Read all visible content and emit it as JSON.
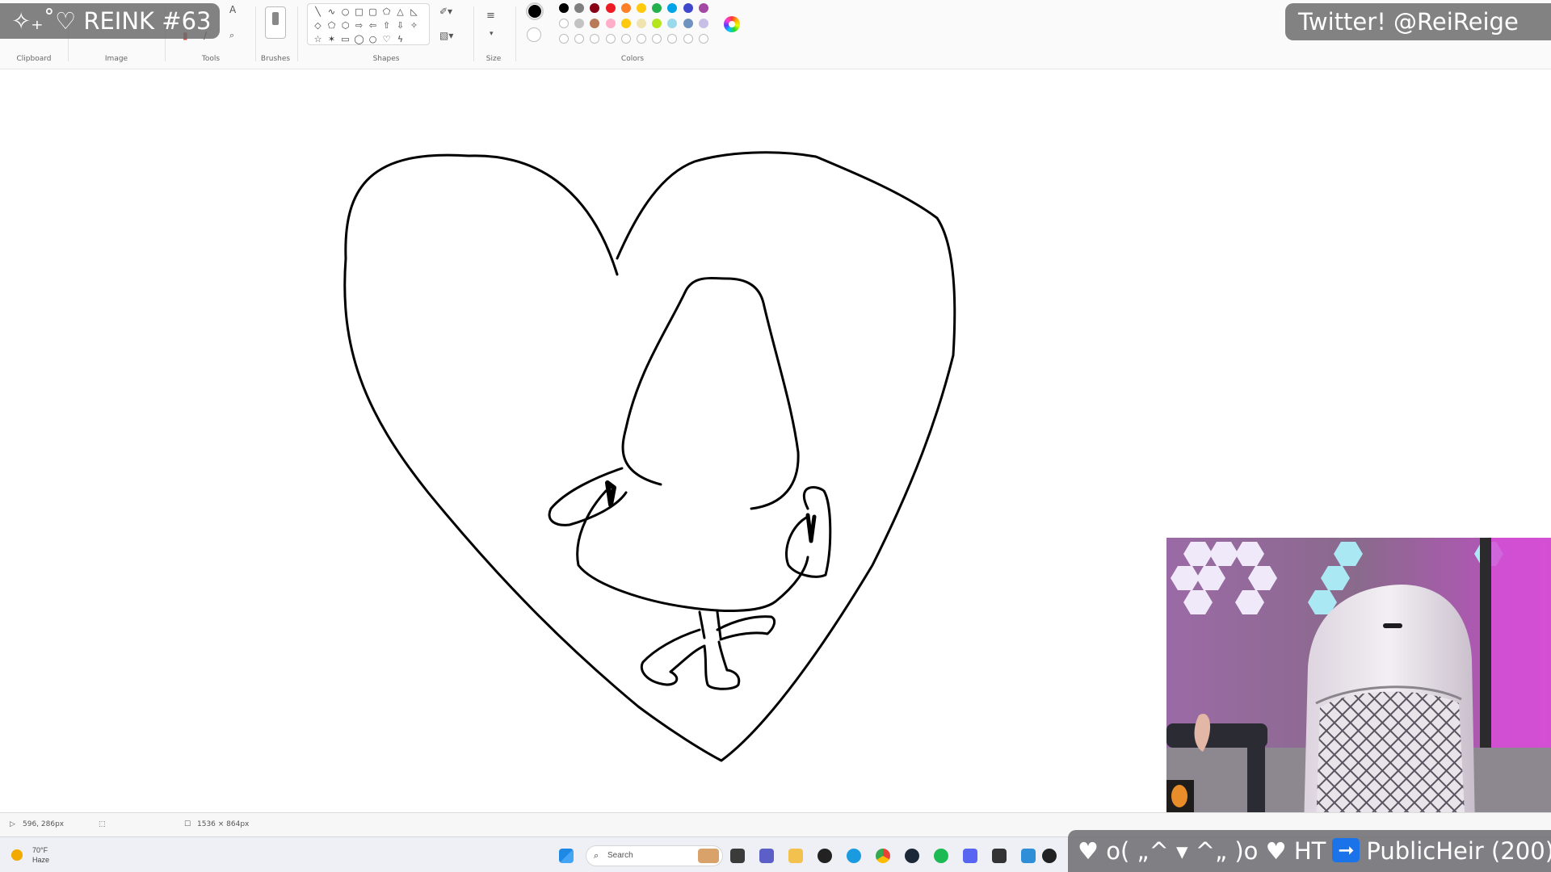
{
  "overlay": {
    "episode": "✧₊˚♡ REINK #63",
    "twitter": "Twitter! @ReiReige",
    "alert_prefix": "♥ o( „^ ▾ ^„ )o ♥ HT",
    "alert_arrow": "➞",
    "alert_user": "PublicHeir (200)"
  },
  "ribbon": {
    "groups": [
      "Clipboard",
      "Image",
      "Tools",
      "Brushes",
      "Shapes",
      "Size",
      "Colors"
    ]
  },
  "palette": {
    "current_primary": "#000000",
    "current_secondary": "#ffffff",
    "row1": [
      "#000000",
      "#7f7f7f",
      "#880015",
      "#ed1c24",
      "#ff7f27",
      "#ffc90e",
      "#22b14c",
      "#00a2e8",
      "#3f48cc",
      "#a349a4"
    ],
    "row2": [
      "#ffffff",
      "#c3c3c3",
      "#b97a57",
      "#ffaec9",
      "#ffc90e",
      "#efe4b0",
      "#b5e61d",
      "#99d9ea",
      "#7092be",
      "#c8bfe7"
    ]
  },
  "statusbar": {
    "cursor_pos": "596, 286px",
    "canvas_size": "1536 × 864px"
  },
  "taskbar": {
    "search_placeholder": "Search",
    "weather_temp": "70°F",
    "weather_desc": "Haze"
  }
}
